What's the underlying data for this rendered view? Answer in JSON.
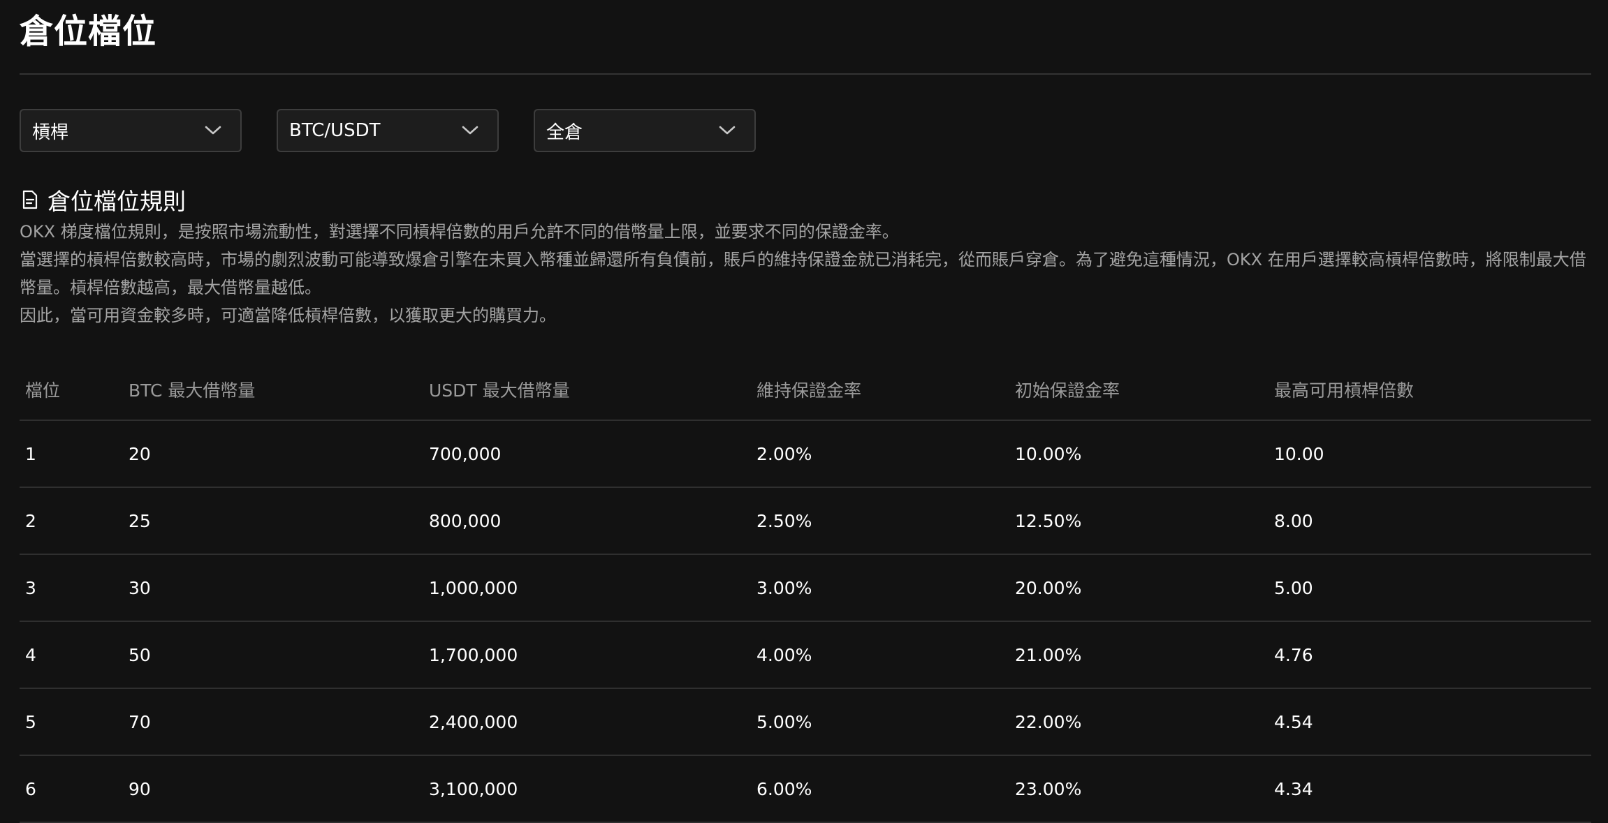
{
  "page": {
    "title": "倉位檔位"
  },
  "filters": [
    {
      "value": "槓桿"
    },
    {
      "value": "BTC/USDT"
    },
    {
      "value": "全倉"
    }
  ],
  "rules": {
    "title": "倉位檔位規則",
    "paragraphs": [
      "OKX 梯度檔位規則，是按照市場流動性，對選擇不同槓桿倍數的用戶允許不同的借幣量上限，並要求不同的保證金率。",
      "當選擇的槓桿倍數較高時，市場的劇烈波動可能導致爆倉引擎在未買入幣種並歸還所有負債前，賬戶的維持保證金就已消耗完，從而賬戶穿倉。為了避免這種情況，OKX 在用戶選擇較高槓桿倍數時，將限制最大借幣量。槓桿倍數越高，最大借幣量越低。",
      "因此，當可用資金較多時，可適當降低槓桿倍數，以獲取更大的購買力。"
    ]
  },
  "table": {
    "headers": [
      "檔位",
      "BTC 最大借幣量",
      "USDT 最大借幣量",
      "維持保證金率",
      "初始保證金率",
      "最高可用槓桿倍數"
    ],
    "rows": [
      [
        "1",
        "20",
        "700,000",
        "2.00%",
        "10.00%",
        "10.00"
      ],
      [
        "2",
        "25",
        "800,000",
        "2.50%",
        "12.50%",
        "8.00"
      ],
      [
        "3",
        "30",
        "1,000,000",
        "3.00%",
        "20.00%",
        "5.00"
      ],
      [
        "4",
        "50",
        "1,700,000",
        "4.00%",
        "21.00%",
        "4.76"
      ],
      [
        "5",
        "70",
        "2,400,000",
        "5.00%",
        "22.00%",
        "4.54"
      ],
      [
        "6",
        "90",
        "3,100,000",
        "6.00%",
        "23.00%",
        "4.34"
      ]
    ]
  },
  "icons": {
    "dropdown": "chevron-down-icon",
    "rules": "document-icon"
  }
}
